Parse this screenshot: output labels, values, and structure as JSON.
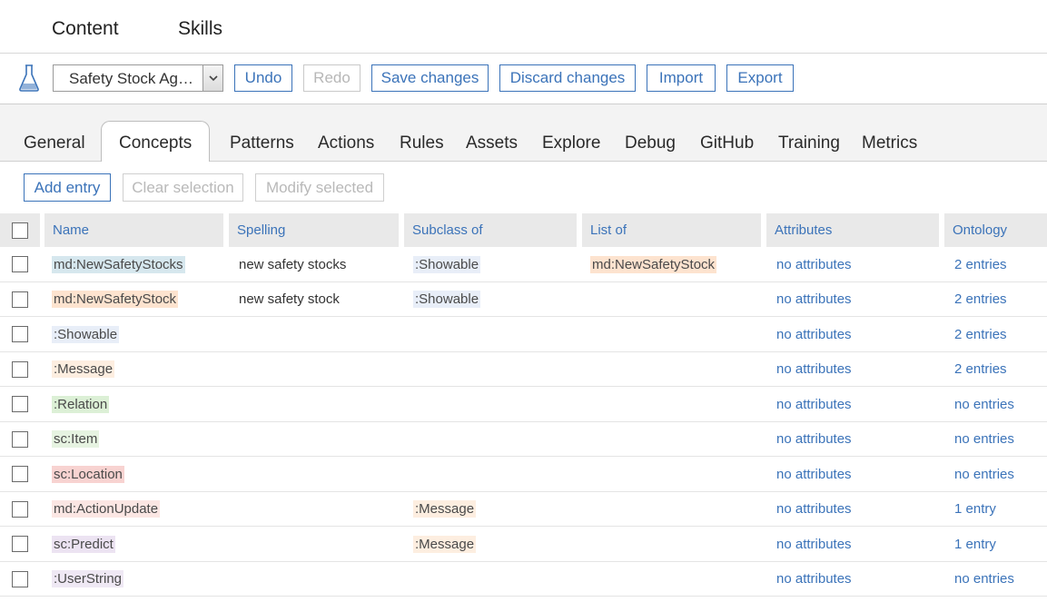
{
  "topnav": {
    "items": [
      "Content",
      "Skills"
    ]
  },
  "toolbar": {
    "selected_workspace": "Safety Stock Ag…",
    "undo": "Undo",
    "redo": "Redo",
    "save": "Save changes",
    "discard": "Discard changes",
    "import": "Import",
    "export": "Export"
  },
  "tabs": [
    "General",
    "Concepts",
    "Patterns",
    "Actions",
    "Rules",
    "Assets",
    "Explore",
    "Debug",
    "GitHub",
    "Training",
    "Metrics"
  ],
  "active_tab": "Concepts",
  "actions": {
    "add": "Add entry",
    "clear": "Clear selection",
    "modify": "Modify selected"
  },
  "table": {
    "headers": [
      "Name",
      "Spelling",
      "Subclass of",
      "List of",
      "Attributes",
      "Ontology"
    ],
    "rows": [
      {
        "name": "md:NewSafetyStocks",
        "name_color": "#d6e7ee",
        "spelling": "new safety stocks",
        "subclass": ":Showable",
        "subclass_color": "#e8eef8",
        "listof": "md:NewSafetyStock",
        "listof_color": "#fde3cf",
        "attributes": "no attributes",
        "ontology": "2 entries"
      },
      {
        "name": "md:NewSafetyStock",
        "name_color": "#fde3cf",
        "spelling": "new safety stock",
        "subclass": ":Showable",
        "subclass_color": "#e8eef8",
        "listof": "",
        "listof_color": "",
        "attributes": "no attributes",
        "ontology": "2 entries"
      },
      {
        "name": ":Showable",
        "name_color": "#e8eef8",
        "spelling": "",
        "subclass": "",
        "subclass_color": "",
        "listof": "",
        "listof_color": "",
        "attributes": "no attributes",
        "ontology": "2 entries"
      },
      {
        "name": ":Message",
        "name_color": "#fdeee0",
        "spelling": "",
        "subclass": "",
        "subclass_color": "",
        "listof": "",
        "listof_color": "",
        "attributes": "no attributes",
        "ontology": "2 entries"
      },
      {
        "name": ":Relation",
        "name_color": "#dcf0d6",
        "spelling": "",
        "subclass": "",
        "subclass_color": "",
        "listof": "",
        "listof_color": "",
        "attributes": "no attributes",
        "ontology": "no entries"
      },
      {
        "name": "sc:Item",
        "name_color": "#e6f3e1",
        "spelling": "",
        "subclass": "",
        "subclass_color": "",
        "listof": "",
        "listof_color": "",
        "attributes": "no attributes",
        "ontology": "no entries"
      },
      {
        "name": "sc:Location",
        "name_color": "#f8d3d1",
        "spelling": "",
        "subclass": "",
        "subclass_color": "",
        "listof": "",
        "listof_color": "",
        "attributes": "no attributes",
        "ontology": "no entries"
      },
      {
        "name": "md:ActionUpdate",
        "name_color": "#fbe6e3",
        "spelling": "",
        "subclass": ":Message",
        "subclass_color": "#fdeee0",
        "listof": "",
        "listof_color": "",
        "attributes": "no attributes",
        "ontology": "1 entry"
      },
      {
        "name": "sc:Predict",
        "name_color": "#ece3f2",
        "spelling": "",
        "subclass": ":Message",
        "subclass_color": "#fdeee0",
        "listof": "",
        "listof_color": "",
        "attributes": "no attributes",
        "ontology": "1 entry"
      },
      {
        "name": ":UserString",
        "name_color": "#efe8f4",
        "spelling": "",
        "subclass": "",
        "subclass_color": "",
        "listof": "",
        "listof_color": "",
        "attributes": "no attributes",
        "ontology": "no entries"
      }
    ]
  }
}
